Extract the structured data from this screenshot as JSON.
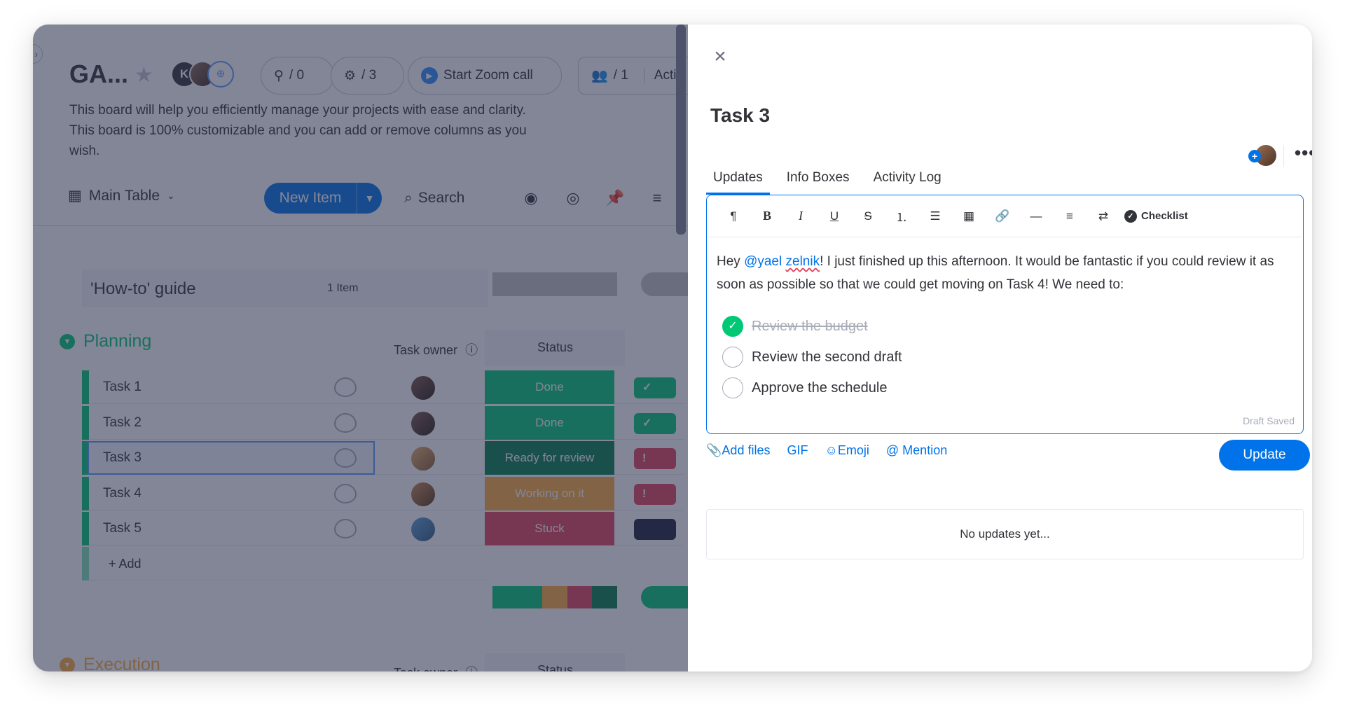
{
  "board": {
    "title": "GA...",
    "avatar_initial": "K",
    "integrations_count": "/ 0",
    "automations_count": "/ 3",
    "zoom_label": "Start Zoom call",
    "members_count": "/ 1",
    "activity_label": "Acti",
    "description": "This board will help you efficiently manage your projects with ease and clarity. This board is 100% customizable and you can add or remove columns as you wish.",
    "view_label": "Main Table",
    "new_item_label": "New Item",
    "search_label": "Search"
  },
  "groups": {
    "guide": {
      "name": "'How-to' guide",
      "count": "1 Item"
    },
    "planning": {
      "name": "Planning",
      "color": "#00c875",
      "owner_col": "Task owner",
      "status_col": "Status",
      "tasks": [
        {
          "name": "Task 1",
          "status": "Done",
          "status_color": "#00c875",
          "extra": "✓",
          "extra_color": "#00c875"
        },
        {
          "name": "Task 2",
          "status": "Done",
          "status_color": "#00c875",
          "extra": "✓",
          "extra_color": "#00c875"
        },
        {
          "name": "Task 3",
          "status": "Ready for review",
          "status_color": "#037f4c",
          "extra": "!",
          "extra_color": "#e2445c"
        },
        {
          "name": "Task 4",
          "status": "Working on it",
          "status_color": "#fdab3d",
          "extra": "!",
          "extra_color": "#e2445c"
        },
        {
          "name": "Task 5",
          "status": "Stuck",
          "status_color": "#e2445c",
          "extra": "",
          "extra_color": "#1c1f3b"
        }
      ],
      "add_label": "+ Add",
      "summary_colors": [
        "#00c875",
        "#00c875",
        "#fdab3d",
        "#e2445c",
        "#037f4c"
      ]
    },
    "execution": {
      "name": "Execution",
      "color": "#fdab3d",
      "owner_col": "Task owner",
      "status_col": "Status"
    }
  },
  "panel": {
    "title": "Task 3",
    "tabs": [
      "Updates",
      "Info Boxes",
      "Activity Log"
    ],
    "active_tab": "Updates",
    "more_label": "•••",
    "editor": {
      "checklist_label": "Checklist",
      "text_before": "Hey ",
      "mention_at": "@yael",
      "mention_space": " ",
      "mention_name": "zelnik",
      "text_after": "! I just finished up this afternoon. It would be fantastic if you could review it as soon as possible so that we could get moving on Task 4! We need to:",
      "checklist": [
        {
          "label": "Review the budget",
          "done": true
        },
        {
          "label": "Review the second draft",
          "done": false
        },
        {
          "label": "Approve the schedule",
          "done": false
        }
      ],
      "draft_status": "Draft Saved"
    },
    "actions": {
      "add_files": "Add files",
      "gif": "GIF",
      "emoji": "Emoji",
      "mention": "Mention"
    },
    "update_label": "Update",
    "empty_state": "No updates yet..."
  },
  "colors": {
    "primary": "#0073ea",
    "done": "#00c875",
    "working": "#fdab3d",
    "stuck": "#e2445c",
    "ready": "#037f4c"
  }
}
